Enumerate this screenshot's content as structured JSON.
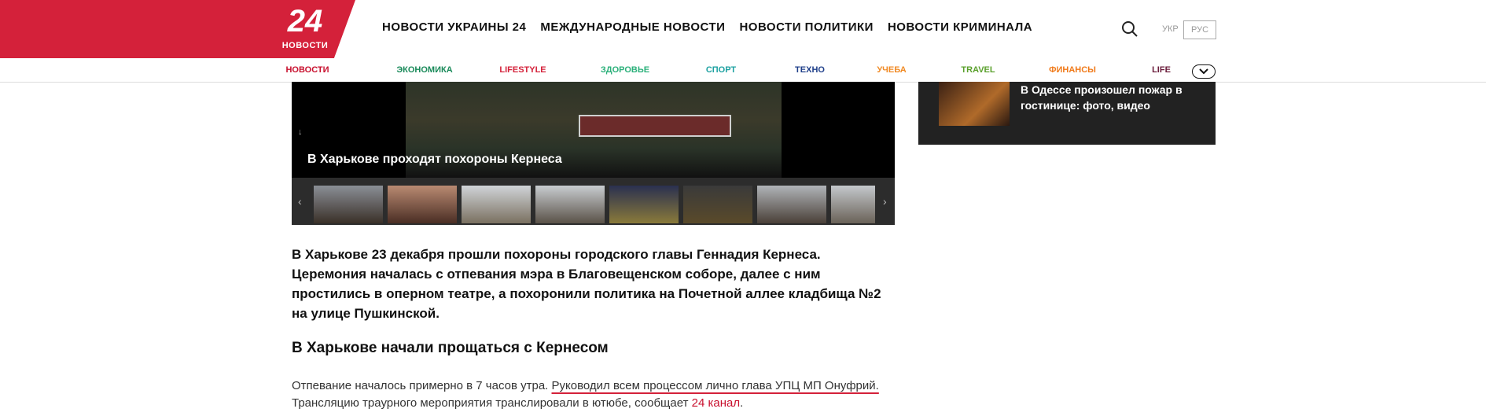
{
  "logo": {
    "number": "24",
    "label": "НОВОСТИ"
  },
  "main_nav": [
    "НОВОСТИ УКРАИНЫ 24",
    "МЕЖДУНАРОДНЫЕ НОВОСТИ",
    "НОВОСТИ ПОЛИТИКИ",
    "НОВОСТИ КРИМИНАЛА"
  ],
  "lang": {
    "ukr": "УКР",
    "rus": "РУС"
  },
  "sub_nav": [
    {
      "label": "НОВОСТИ",
      "color": "#c8102e"
    },
    {
      "label": "ЭКОНОМИКА",
      "color": "#1a8a5a"
    },
    {
      "label": "LIFESTYLE",
      "color": "#d4213a"
    },
    {
      "label": "ЗДОРОВЬЕ",
      "color": "#2bb07a"
    },
    {
      "label": "СПОРТ",
      "color": "#1da1a1"
    },
    {
      "label": "ТЕХНО",
      "color": "#1f3f8a"
    },
    {
      "label": "УЧЕБА",
      "color": "#f08a24"
    },
    {
      "label": "TRAVEL",
      "color": "#5aa02c"
    },
    {
      "label": "ФИНАНСЫ",
      "color": "#f07a1a"
    },
    {
      "label": "LIFE",
      "color": "#6a1b3a"
    }
  ],
  "gallery": {
    "caption": "В Харькове проходят похороны Кернеса",
    "prev_arrow": "‹",
    "next_arrow": "›",
    "down_arrow": "↓",
    "thumb_count": 8
  },
  "sidebar": {
    "title": "В Одессе произошел пожар в гостинице: фото, видео"
  },
  "article": {
    "lead": "В Харькове 23 декабря прошли похороны городского главы Геннадия Кернеса. Церемония началась с отпевания мэра в Благовещенском соборе, далее с ним простились в оперном театре, а похоронили политика на Почетной аллее кладбища №2 на улице Пушкинской.",
    "heading": "В Харькове начали прощаться с Кернесом",
    "para_start": "Отпевание началось примерно в 7 часов утра. ",
    "para_highlight": "Руководил всем процессом лично глава УПЦ МП Онуфрий.",
    "para_middle": " Трансляцию траурного мероприятия транслировали в ютюбе, сообщает ",
    "para_link": "24 канал",
    "para_end": "."
  }
}
